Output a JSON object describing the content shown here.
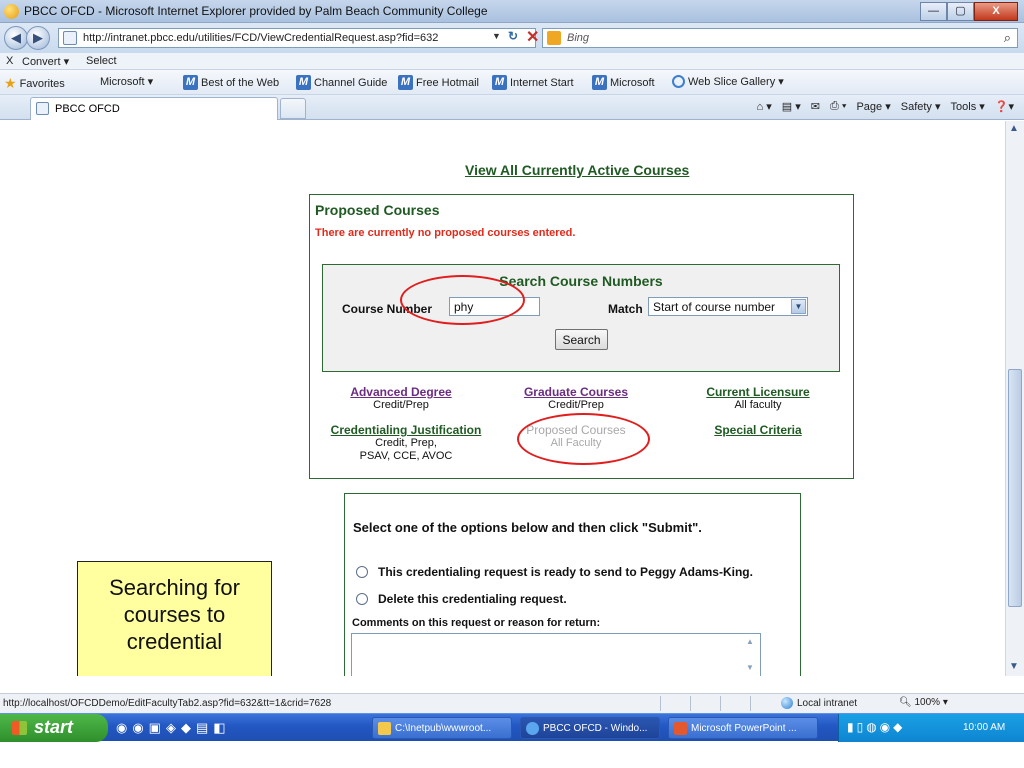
{
  "window": {
    "title": "PBCC OFCD - Microsoft Internet Explorer provided by Palm Beach Community College",
    "min_glyph": "—",
    "max_glyph": "▢",
    "close_glyph": "X"
  },
  "address": {
    "url": "http://intranet.pbcc.edu/utilities/FCD/ViewCredentialRequest.asp?fid=632",
    "search_placeholder": "Bing"
  },
  "command_bar": {
    "convert_label": "Convert ▾",
    "select_label": "Select",
    "close_glyph": "X"
  },
  "favorites_bar": {
    "favorites_label": "Favorites",
    "items": [
      "Microsoft ▾",
      "Best of the Web",
      "Channel Guide",
      "Free Hotmail",
      "Internet Start",
      "Microsoft",
      "Web Slice Gallery ▾"
    ]
  },
  "tabs": {
    "active_label": "PBCC OFCD",
    "tools": [
      "Page ▾",
      "Safety ▾",
      "Tools ▾"
    ]
  },
  "page": {
    "view_all_link": "View All Currently Active Courses",
    "proposed": {
      "heading": "Proposed Courses",
      "empty_message": "There are currently no proposed courses entered."
    },
    "search": {
      "heading": "Search Course Numbers",
      "course_number_label": "Course Number",
      "course_number_value": "phy",
      "match_label": "Match",
      "match_value": "Start of course number",
      "search_button": "Search"
    },
    "options": [
      {
        "link": "Advanced Degree",
        "sub": "Credit/Prep"
      },
      {
        "link": "Graduate Courses",
        "sub": "Credit/Prep"
      },
      {
        "link": "Current Licensure",
        "sub": "All faculty"
      },
      {
        "link": "Credentialing Justification",
        "sub1": "Credit, Prep,",
        "sub2": "PSAV, CCE, AVOC"
      },
      {
        "link": "Proposed Courses",
        "sub": "All Faculty"
      },
      {
        "link": "Special Criteria"
      }
    ],
    "submit": {
      "heading": "Select one of the options below and then click \"Submit\".",
      "option_send": "This credentialing request is ready to send to Peggy Adams-King.",
      "option_delete": "Delete this credentialing request.",
      "comments_label": "Comments on this request or reason for return:"
    },
    "callout": {
      "line1": "Searching for",
      "line2": "courses to",
      "line3": "credential"
    }
  },
  "status_bar": {
    "url": "http://localhost/OFCDDemo/EditFacultyTab2.asp?fid=632&tt=1&crid=7628",
    "zone": "Local intranet",
    "zoom": "100%"
  },
  "taskbar": {
    "start_label": "start",
    "items": [
      "C:\\Inetpub\\wwwroot...",
      "PBCC OFCD - Windo...",
      "Microsoft PowerPoint ..."
    ],
    "clock": "10:00 AM"
  },
  "colors": {
    "heading_green": "#1f5a22",
    "error_red": "#e02a1c",
    "annotation_red": "#e01e1e",
    "callout_yellow": "#ffffa0"
  }
}
